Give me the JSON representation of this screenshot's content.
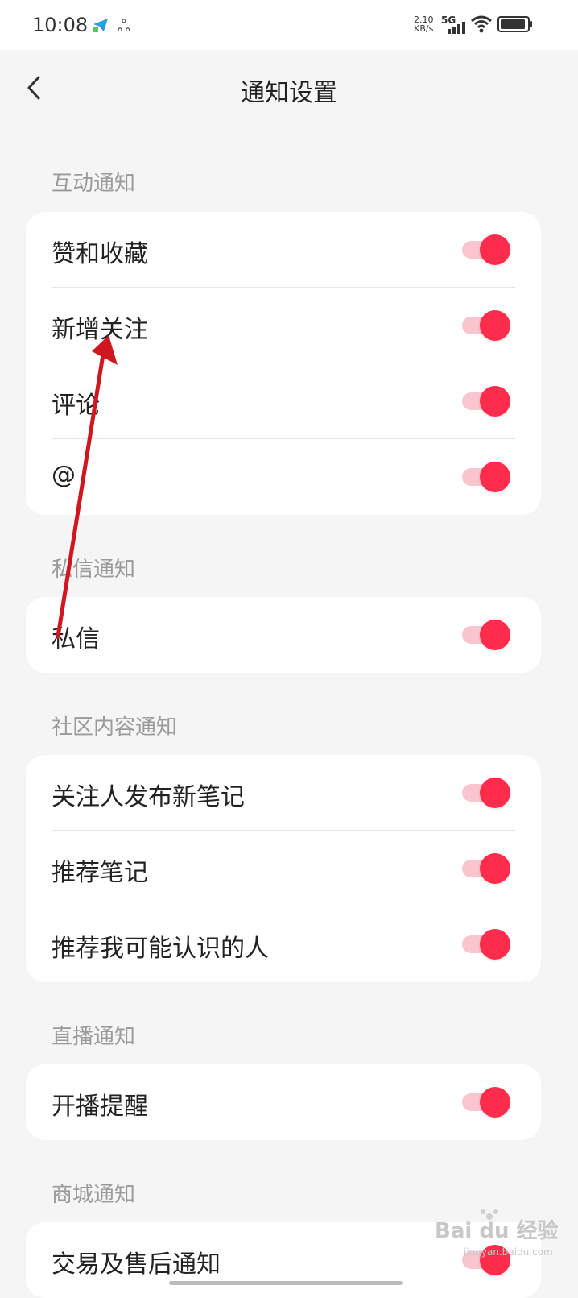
{
  "status_bar": {
    "time": "10:08",
    "net_speed_value": "2.10",
    "net_speed_unit": "KB/s",
    "network": "5G",
    "icons": [
      "telegram-icon",
      "app-icon",
      "signal-icon",
      "wifi-icon",
      "battery-icon"
    ]
  },
  "nav": {
    "title": "通知设置",
    "back_icon": "chevron-left-icon"
  },
  "sections": [
    {
      "title": "互动通知",
      "items": [
        {
          "label": "赞和收藏",
          "enabled": true
        },
        {
          "label": "新增关注",
          "enabled": true
        },
        {
          "label": "评论",
          "enabled": true
        },
        {
          "label": "@",
          "enabled": true
        }
      ]
    },
    {
      "title": "私信通知",
      "items": [
        {
          "label": "私信",
          "enabled": true
        }
      ]
    },
    {
      "title": "社区内容通知",
      "items": [
        {
          "label": "关注人发布新笔记",
          "enabled": true
        },
        {
          "label": "推荐笔记",
          "enabled": true
        },
        {
          "label": "推荐我可能认识的人",
          "enabled": true
        }
      ]
    },
    {
      "title": "直播通知",
      "items": [
        {
          "label": "开播提醒",
          "enabled": true
        }
      ]
    },
    {
      "title": "商城通知",
      "items": [
        {
          "label": "交易及售后通知",
          "enabled": true
        }
      ]
    }
  ],
  "colors": {
    "accent": "#ff2d4b",
    "track": "#f9c6cf",
    "annotation_arrow": "#d0161e"
  },
  "watermark": {
    "brand": "Bai du 经验",
    "url": "jingyan.baidu.com"
  }
}
